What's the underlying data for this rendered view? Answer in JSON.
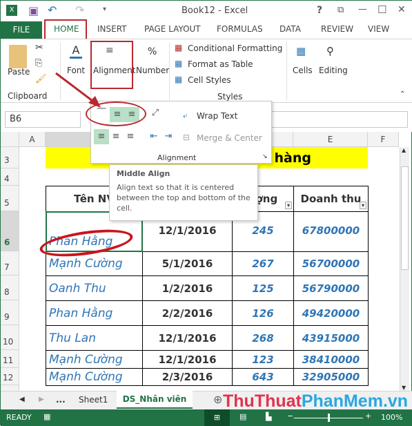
{
  "window": {
    "title": "Book12 - Excel",
    "help": "?",
    "restore": "⧉",
    "minimize": "—",
    "maximize": "☐",
    "close": "✕"
  },
  "tabs": {
    "file": "FILE",
    "items": [
      "HOME",
      "INSERT",
      "PAGE LAYOUT",
      "FORMULAS",
      "DATA",
      "REVIEW",
      "VIEW"
    ]
  },
  "ribbon": {
    "paste": "Paste",
    "clipboard": "Clipboard",
    "font": "Font",
    "alignment": "Alignment",
    "number": "Number",
    "number_icon": "%",
    "conditional": "Conditional Formatting",
    "format_table": "Format as Table",
    "cell_styles": "Cell Styles",
    "styles": "Styles",
    "cells": "Cells",
    "editing": "Editing"
  },
  "formula_bar": {
    "name_box": "B6"
  },
  "alignment_popup": {
    "wrap_text": "Wrap Text",
    "merge_center": "Merge & Center",
    "group_label": "Alignment"
  },
  "tooltip": {
    "title": "Middle Align",
    "body": "Align text so that it is centered between the top and bottom of the cell."
  },
  "columns": [
    "A",
    "B",
    "C",
    "D",
    "E",
    "F"
  ],
  "rows": [
    "3",
    "4",
    "5",
    "6",
    "7",
    "8",
    "9",
    "10",
    "11",
    "12"
  ],
  "sheet": {
    "title_visible": "hàng",
    "headers": [
      "Tên NV",
      "",
      "ượng",
      "Doanh thu"
    ],
    "data": [
      [
        "Phan Hằng",
        "12/1/2016",
        "245",
        "67800000"
      ],
      [
        "Mạnh Cường",
        "5/1/2016",
        "267",
        "56700000"
      ],
      [
        "Oanh Thu",
        "1/2/2016",
        "125",
        "56790000"
      ],
      [
        "Phan Hằng",
        "2/2/2016",
        "126",
        "49420000"
      ],
      [
        "Thu Lan",
        "12/1/2016",
        "268",
        "43915000"
      ],
      [
        "Mạnh Cường",
        "12/1/2016",
        "123",
        "38410000"
      ],
      [
        "Mạnh Cường",
        "2/3/2016",
        "643",
        "32905000"
      ]
    ]
  },
  "sheet_tabs": {
    "more": "...",
    "items": [
      "Sheet1",
      "DS_Nhân viên"
    ],
    "active": 1
  },
  "watermark": {
    "part1": "ThuThuat",
    "part2": "PhanMem",
    "part3": ".vn"
  },
  "status": {
    "ready": "READY",
    "zoom": "100%",
    "zoom_level": 0.5
  },
  "colors": {
    "excel_green": "#217346",
    "highlight_red": "#b7282e",
    "title_yellow": "#ffff00",
    "data_blue": "#2e75b6"
  }
}
